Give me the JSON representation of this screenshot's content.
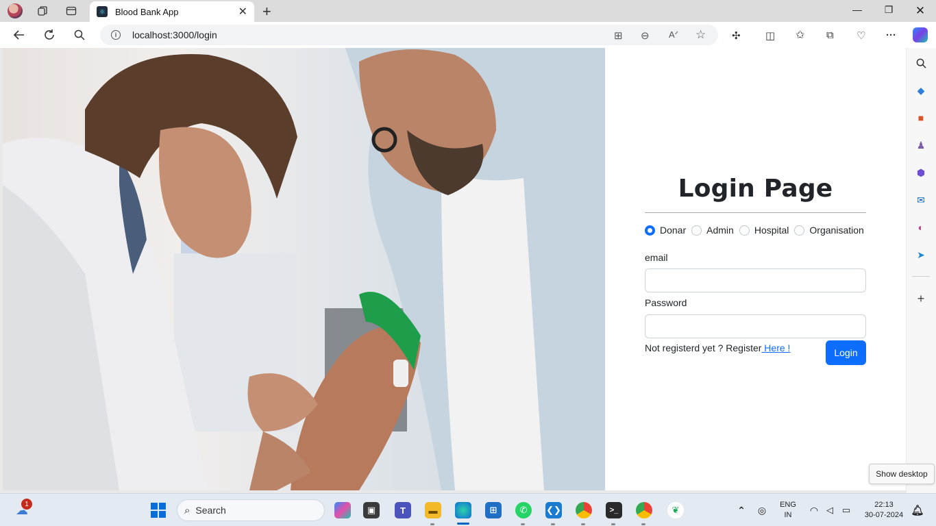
{
  "browser": {
    "tab_title": "Blood Bank App",
    "url": "localhost:3000/login"
  },
  "login": {
    "heading": "Login Page",
    "roles": [
      "Donar",
      "Admin",
      "Hospital",
      "Organisation"
    ],
    "selected_role": "Donar",
    "email_label": "email",
    "email_value": "",
    "password_label": "Password",
    "password_value": "",
    "register_prompt": "Not registerd yet ? Register",
    "register_link": " Here !",
    "login_button": "Login"
  },
  "tooltip": "Show desktop",
  "taskbar": {
    "search_placeholder": "Search",
    "notification_count": "1",
    "lang_line1": "ENG",
    "lang_line2": "IN",
    "time": "22:13",
    "date": "30-07-2024"
  },
  "colors": {
    "primary": "#0d6efd",
    "heading": "#212529"
  }
}
